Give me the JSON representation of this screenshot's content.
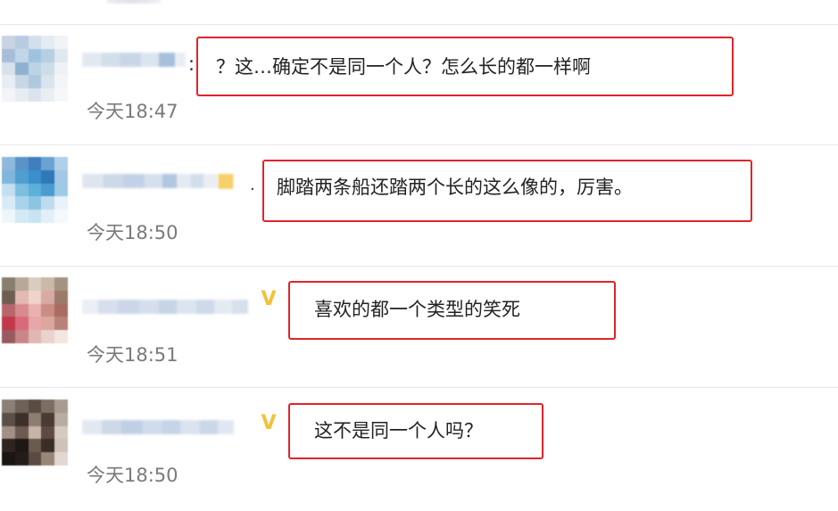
{
  "comments": [
    {
      "prefix": "：",
      "text": "？这…确定不是同一个人？怎么长的都一样啊",
      "time": "今天18:47",
      "vip": false,
      "avatar_colors": [
        "#c8d4e3",
        "#b9cbe1",
        "#d5dfec",
        "#e5ebf2",
        "#f0f3f7",
        "#a7bdd8",
        "#c2d6e9",
        "#9ec3de",
        "#b6cfe3",
        "#dfe7ef",
        "#d6e1ec",
        "#8fb1cf",
        "#bcd3e6",
        "#cbdde8",
        "#eef2f6",
        "#e8edf3",
        "#c7d7e6",
        "#afc8dd",
        "#d9e4ee",
        "#f3f5f8",
        "#f2f4f7",
        "#e7ecf2",
        "#dbe4ee",
        "#eaeef3",
        "#f6f7f9"
      ]
    },
    {
      "prefix": ".",
      "text": "脚踏两条船还踏两个长的这么像的，厉害。",
      "time": "今天18:50",
      "vip": true,
      "vip_icon": "vip-badge-icon",
      "avatar_colors": [
        "#8fb9dc",
        "#5a93c8",
        "#3f7fbf",
        "#6aa2d1",
        "#b0cfe8",
        "#7fb6db",
        "#4e9fd0",
        "#3b8fcb",
        "#2f79b8",
        "#a3c7e4",
        "#c4dff0",
        "#7cbfe0",
        "#5ab0d9",
        "#4a9bcf",
        "#9ccbe6",
        "#d8ebf5",
        "#a9d3ec",
        "#8cc4e4",
        "#bfdcef",
        "#e7f2f9",
        "#eef6fb",
        "#d4e9f5",
        "#c9e3f2",
        "#e2eff8",
        "#f4f9fc"
      ]
    },
    {
      "prefix": "",
      "text": "喜欢的都一个类型的笑死",
      "time": "今天18:51",
      "vip": true,
      "vip_icon": "vip-badge-icon",
      "avatar_colors": [
        "#8a7f6f",
        "#b7a99a",
        "#d9cdbf",
        "#cbb9a7",
        "#a49383",
        "#6e5d52",
        "#e2b9b3",
        "#f1d3cc",
        "#d8aaa3",
        "#9c7a6b",
        "#b7676b",
        "#d98a8d",
        "#e9b2b0",
        "#c98d86",
        "#a86c63",
        "#c2394d",
        "#d96a7a",
        "#e7a6a9",
        "#dca69e",
        "#b98279",
        "#9a5a5f",
        "#c9868a",
        "#e0b7b2",
        "#ead3cc",
        "#f3e6e1"
      ]
    },
    {
      "prefix": "",
      "text": "这不是同一个人吗？",
      "time": "今天18:50",
      "vip": true,
      "vip_icon": "vip-badge-icon",
      "avatar_colors": [
        "#8a8078",
        "#6f6258",
        "#5a4c43",
        "#7d6e63",
        "#a89a8f",
        "#5c4f48",
        "#3d3029",
        "#8f7d71",
        "#4a3b33",
        "#b9aca2",
        "#a38f85",
        "#6d5a51",
        "#c7b5aa",
        "#5e4a42",
        "#d6c9c0",
        "#2e2520",
        "#1e1814",
        "#6b5a50",
        "#3a2d27",
        "#cfc2b9",
        "#1a1512",
        "#241c18",
        "#5b4a41",
        "#988679",
        "#e2d8d1"
      ]
    }
  ]
}
